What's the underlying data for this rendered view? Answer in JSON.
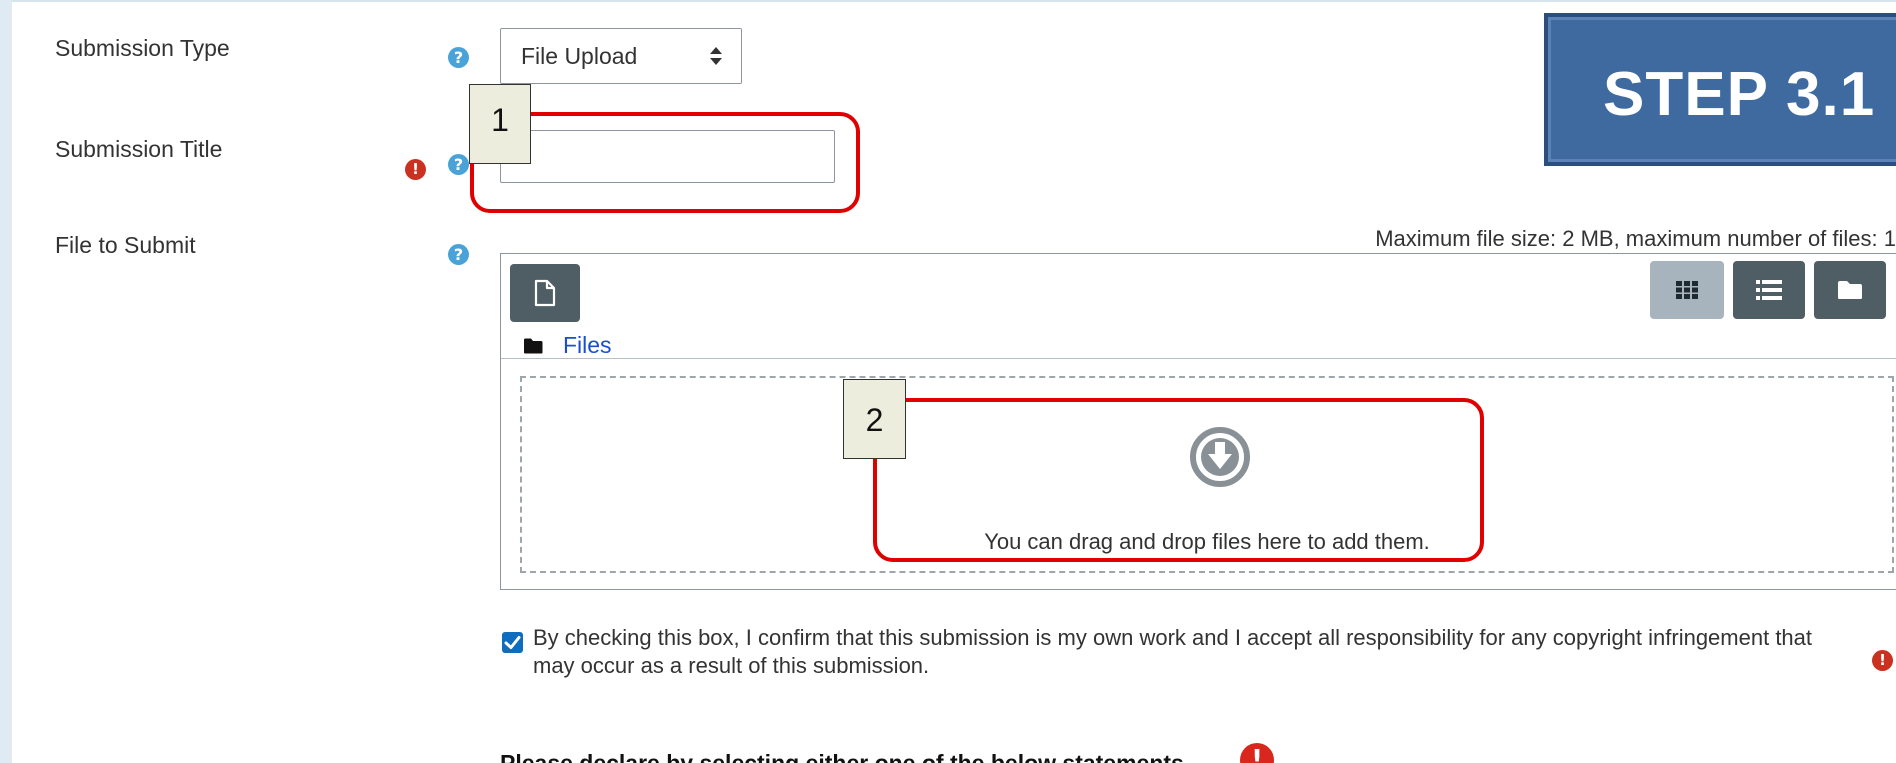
{
  "form": {
    "submission_type": {
      "label": "Submission Type",
      "selected": "File Upload",
      "arrows_glyph": "◆"
    },
    "submission_title": {
      "label": "Submission Title",
      "value": "",
      "placeholder": ""
    },
    "file_to_submit": {
      "label": "File to Submit",
      "max_size_note": "Maximum file size: 2 MB, maximum number of files: 1",
      "path_link": "Files",
      "drop_text": "You can drag and drop files here to add them."
    },
    "confirm": {
      "checked": true,
      "text": "By checking this box, I confirm that this submission is my own work and I accept all responsibility for any copyright infringement that may occur as a result of this submission."
    },
    "declare_heading": "Please declare by selecting either one of the below statements"
  },
  "icons": {
    "help": "?",
    "required": "!"
  },
  "annotations": {
    "step_banner": "STEP 3.1",
    "tag_1": "1",
    "tag_2": "2"
  },
  "colors": {
    "callout_red": "#e00000",
    "banner_blue": "#3e6aa0",
    "help_blue": "#4aa3d8",
    "required_red": "#ca3120",
    "link_blue": "#1a4fcc",
    "button_dark": "#4f5d65"
  }
}
